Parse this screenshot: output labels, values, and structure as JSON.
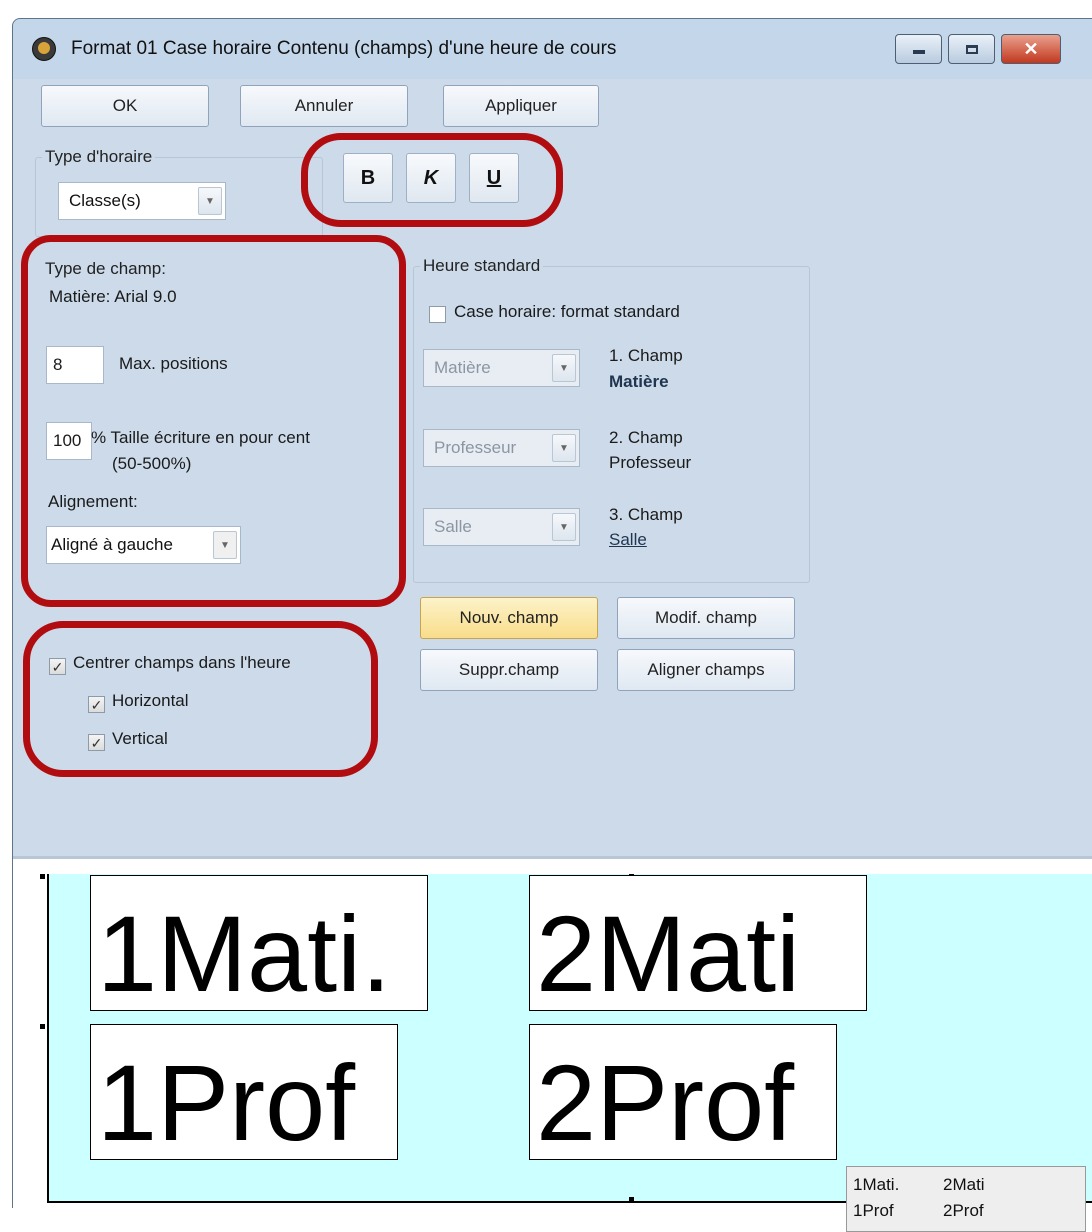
{
  "window": {
    "title": "Format 01  Case horaire  Contenu (champs) d'une heure de cours",
    "controls": {
      "close": "✕"
    }
  },
  "toolbar": {
    "ok": "OK",
    "cancel": "Annuler",
    "apply": "Appliquer"
  },
  "schedule_type": {
    "legend": "Type d'horaire",
    "value": "Classe(s)"
  },
  "format_buttons": {
    "bold": "B",
    "italic": "K",
    "underline": "U"
  },
  "field_type": {
    "legend": "Type de champ:",
    "font_info": "Matière: Arial 9.0",
    "max_positions_value": "8",
    "max_positions_label": "Max. positions",
    "size_value": "100",
    "size_label_1": "% Taille écriture en pour cent",
    "size_label_2": "(50-500%)",
    "alignment_label": "Alignement:",
    "alignment_value": "Aligné à gauche"
  },
  "standard_hour": {
    "legend": "Heure standard",
    "checkbox_label": "Case horaire: format standard",
    "checked": false,
    "fields": [
      {
        "select": "Matière",
        "caption": "1. Champ",
        "name": "Matière"
      },
      {
        "select": "Professeur",
        "caption": "2. Champ",
        "name": "Professeur"
      },
      {
        "select": "Salle",
        "caption": "3. Champ",
        "name": "Salle"
      }
    ]
  },
  "field_buttons": {
    "new": "Nouv. champ",
    "modify": "Modif. champ",
    "delete": "Suppr.champ",
    "align": "Aligner champs"
  },
  "centering": {
    "main_label": "Centrer champs dans l'heure",
    "main_checked": true,
    "horizontal_label": "Horizontal",
    "horizontal_checked": true,
    "vertical_label": "Vertical",
    "vertical_checked": true
  },
  "preview": {
    "fields": [
      "1Mati.",
      "2Mati",
      "1Prof",
      "2Prof"
    ],
    "mini": [
      "1Mati.",
      "2Mati",
      "1Prof",
      "2Prof"
    ]
  },
  "colors": {
    "highlight_ring": "#b10d10",
    "preview_bg": "#ccffff",
    "window_bg": "#ccdaea"
  }
}
